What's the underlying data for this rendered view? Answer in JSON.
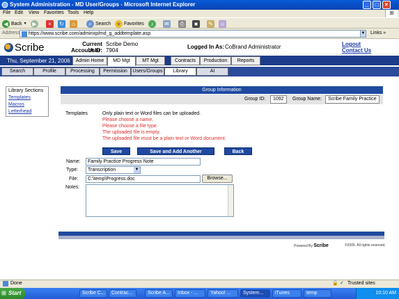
{
  "window": {
    "title": "System Administration - MD User/Groups - Microsoft Internet Explorer",
    "controls": [
      "_",
      "□",
      "×"
    ]
  },
  "menu": [
    "File",
    "Edit",
    "View",
    "Favorites",
    "Tools",
    "Help"
  ],
  "toolbar": {
    "back": "Back",
    "search": "Search",
    "favorites": "Favorites"
  },
  "address": {
    "label": "Address",
    "url": "https://www.scribe.com/adminxp/md_g_addtemplate.asp",
    "links": "Links"
  },
  "header": {
    "logo": "Scribe",
    "current_user_label": "Current User:",
    "current_user": "Scribe Demo",
    "account_id_label": "Account ID:",
    "account_id": "7904",
    "logged_in_label": "Logged In As:",
    "logged_in": "CoBrand Administrator",
    "logout": "Logout",
    "contact": "Contact Us",
    "date": "Thu, September 21, 2006"
  },
  "main_tabs": [
    "Admin Home",
    "MD Mgt",
    "MT Mgt",
    "Contracts",
    "Production",
    "Reports"
  ],
  "sub_tabs": [
    "Search",
    "Profile",
    "Processing",
    "Permission",
    "Users/Groups",
    "Library",
    "AI"
  ],
  "left_nav": {
    "title": "Library Sections",
    "items": [
      "Templates",
      "Macros",
      "Letterhead"
    ]
  },
  "group": {
    "header": "Group Information",
    "id_label": "Group ID:",
    "id": "1092",
    "name_label": "Group Name:",
    "name": "Scribe Family Practice"
  },
  "templates": {
    "label": "Templates",
    "info": "Only plain text or Word files can be uploaded.",
    "errors": [
      "Please choose a name.",
      "Please choose a file type.",
      "The uploaded file is empty.",
      "The uploaded file must be a plain text or Word document."
    ]
  },
  "buttons": {
    "save": "Save",
    "save_add": "Save and Add Another",
    "back": "Back",
    "browse": "Browse..."
  },
  "form": {
    "name_label": "Name:",
    "name_value": "Family Practice Progress Note",
    "type_label": "Type:",
    "type_value": "Transcription",
    "file_label": "File:",
    "file_value": "C:\\temp\\Progress.doc",
    "notes_label": "Notes:",
    "notes_value": ""
  },
  "footer": {
    "powered_by": "Powered By",
    "brand": "Scribe",
    "copyright": "©2005. All rights reserved."
  },
  "status": {
    "left": "Done",
    "right": "Trusted sites"
  },
  "taskbar": {
    "start": "Start",
    "tasks": [
      "Scribe C...",
      "Contrac...",
      "Scribe A...",
      "Inbox - ...",
      "Yahoo! ...",
      "System...",
      "iTunes",
      "temp"
    ],
    "time": "10:10 AM"
  },
  "colors": {
    "nav_blue": "#1c3d8c",
    "error_red": "#e02b2b",
    "link_blue": "#1a3aa8"
  }
}
